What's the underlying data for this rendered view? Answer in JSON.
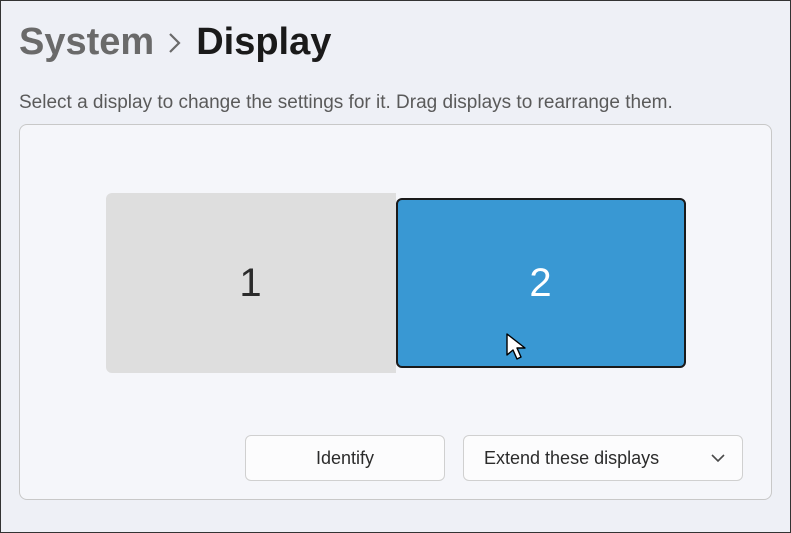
{
  "breadcrumb": {
    "parent": "System",
    "current": "Display"
  },
  "hint": "Select a display to change the settings for it. Drag displays to rearrange them.",
  "displays": {
    "monitor1_label": "1",
    "monitor2_label": "2"
  },
  "controls": {
    "identify_label": "Identify",
    "mode_label": "Extend these displays"
  }
}
